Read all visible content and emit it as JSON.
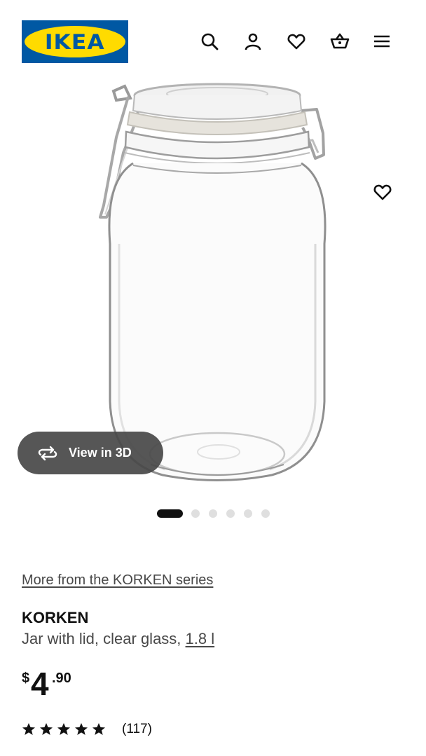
{
  "brand": {
    "logo_text": "IKEA",
    "blue": "#0058a3",
    "yellow": "#ffdb00"
  },
  "header": {
    "icons": [
      "search-icon",
      "profile-icon",
      "heart-icon",
      "cart-icon",
      "menu-icon"
    ]
  },
  "gallery": {
    "view_3d_label": "View in 3D",
    "dot_count": 6,
    "active_index": 0
  },
  "product": {
    "series_link": "More from the KORKEN series",
    "name": "KORKEN",
    "description": "Jar with lid, clear glass,",
    "size": "1.8 l",
    "price": {
      "currency": "$",
      "integer": "4",
      "decimal": ".90"
    },
    "rating": {
      "stars": 5,
      "count": "(117)"
    }
  }
}
